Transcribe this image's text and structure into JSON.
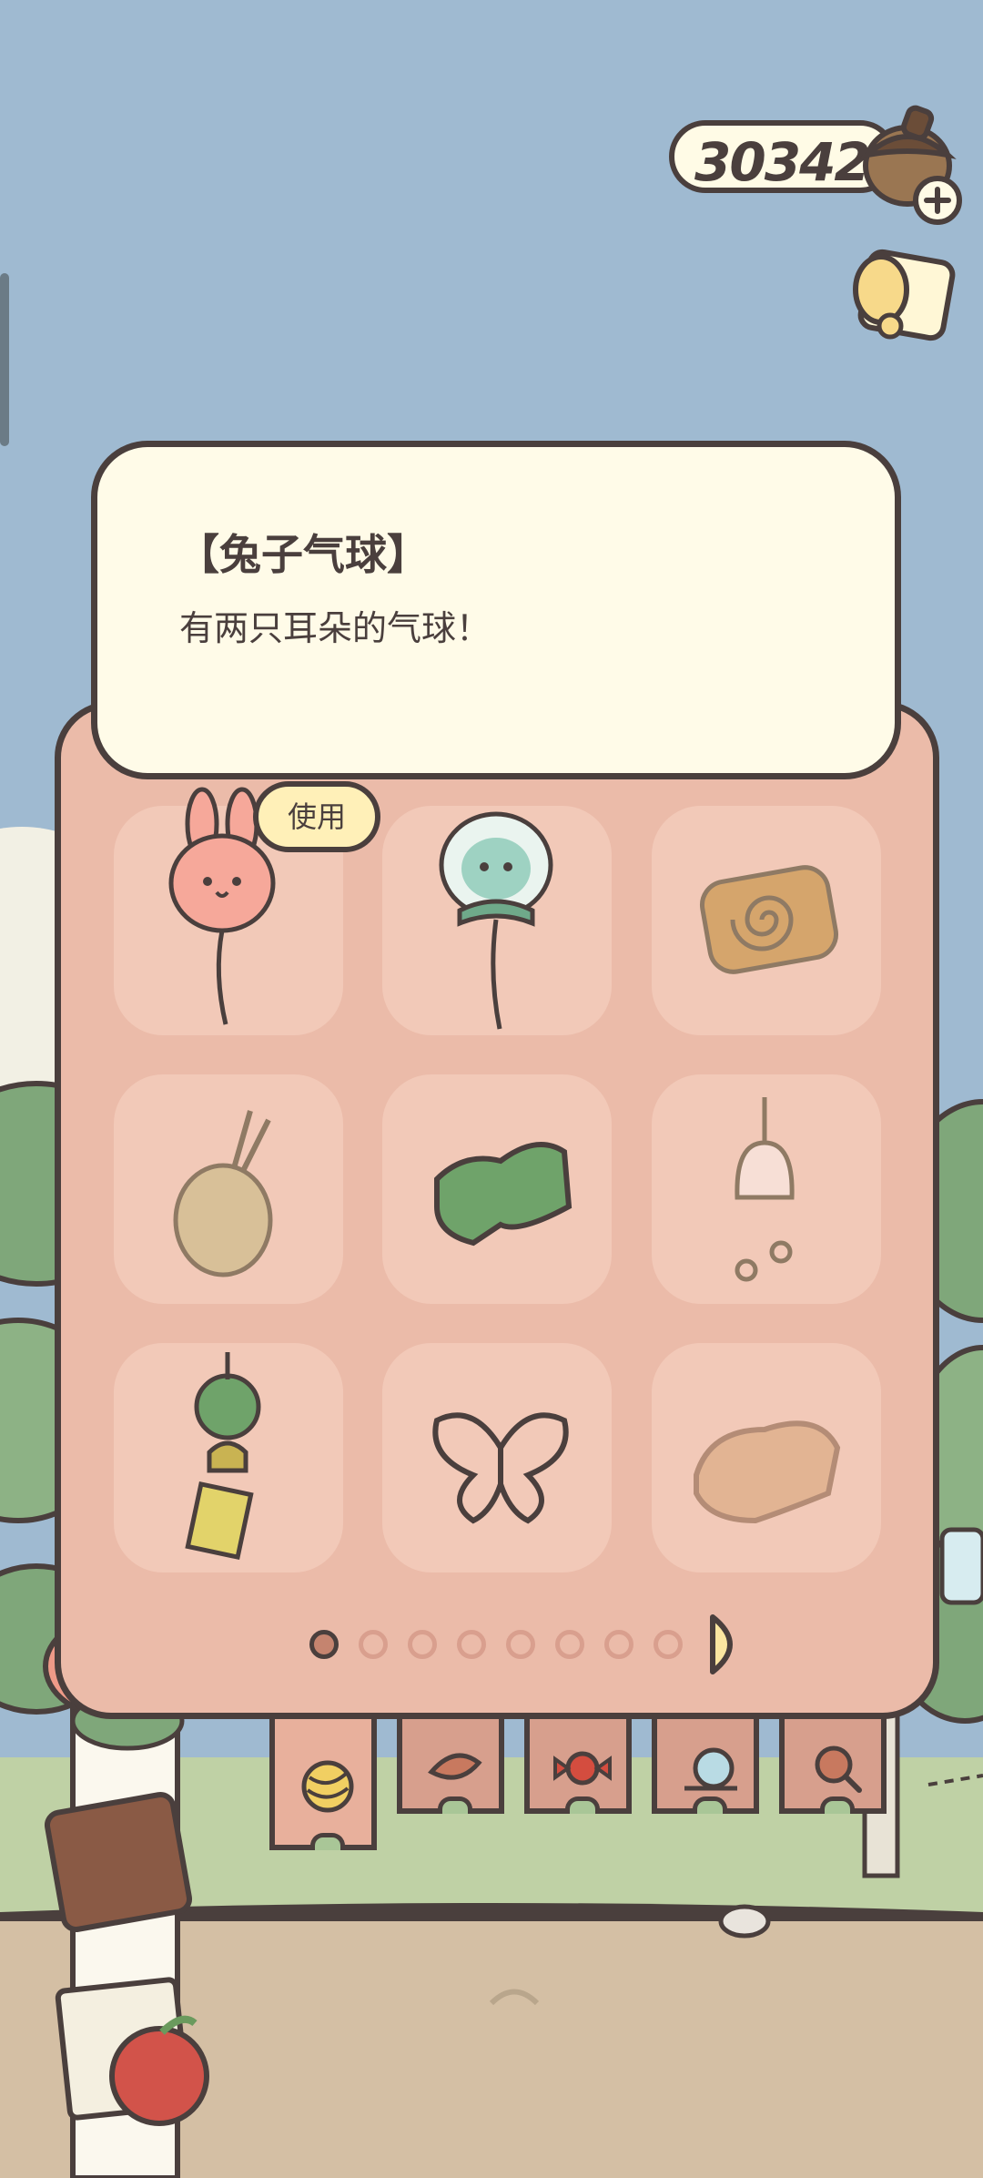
{
  "hud": {
    "currency_amount": "303422",
    "currency_icon": "acorn-icon",
    "add_icon": "plus-icon",
    "mail_icon": "letter-icon"
  },
  "item_detail": {
    "title": "【兔子气球】",
    "description": "有两只耳朵的气球！",
    "use_label": "使用"
  },
  "inventory": {
    "items": [
      {
        "icon": "bunny-balloon-icon",
        "selected": true
      },
      {
        "icon": "jellyfish-balloon-icon"
      },
      {
        "icon": "spiral-cushion-icon"
      },
      {
        "icon": "dried-herb-bundle-icon"
      },
      {
        "icon": "green-mat-icon"
      },
      {
        "icon": "wind-chime-icon"
      },
      {
        "icon": "clover-charm-icon"
      },
      {
        "icon": "butterfly-icon"
      },
      {
        "icon": "bread-log-icon"
      }
    ],
    "page_count": 8,
    "current_page": 1,
    "next_icon": "arrow-right-icon"
  },
  "tabs": [
    {
      "icon": "yarn-ball-icon",
      "active": true
    },
    {
      "icon": "leaf-icon"
    },
    {
      "icon": "candy-icon"
    },
    {
      "icon": "snail-icon"
    },
    {
      "icon": "magnifier-icon"
    }
  ],
  "colors": {
    "sky": "#9fbad1",
    "panel": "#ebbba9",
    "slot": "#f2c9b8",
    "card": "#fffbe8",
    "outline": "#4a3f3d",
    "ground": "#d4bfa4",
    "grass": "#bfd1a5"
  }
}
